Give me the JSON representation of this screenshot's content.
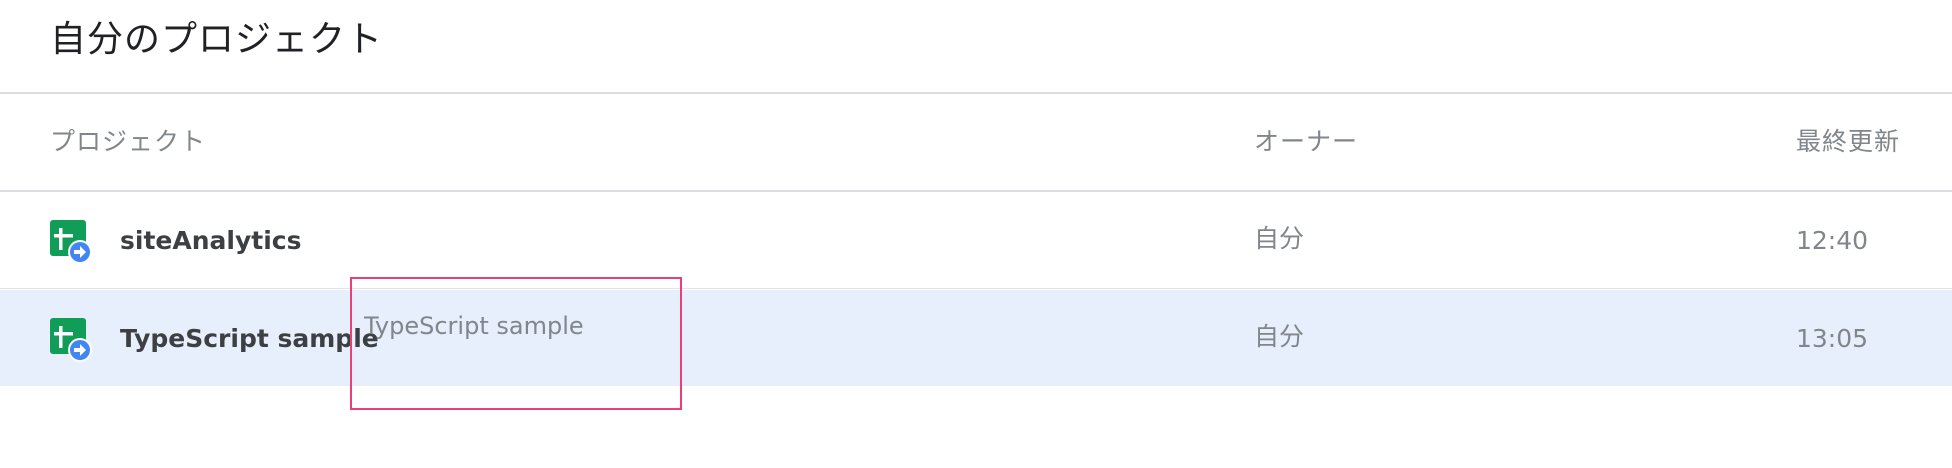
{
  "page": {
    "title": "自分のプロジェクト"
  },
  "columns": {
    "project": "プロジェクト",
    "owner": "オーナー",
    "last_modified": "最終更新"
  },
  "rows": [
    {
      "name": "siteAnalytics",
      "owner": "自分",
      "modified": "12:40",
      "icon": "apps-script-project-icon",
      "selected": false
    },
    {
      "name": "TypeScript sample",
      "owner": "自分",
      "modified": "13:05",
      "icon": "apps-script-project-icon",
      "selected": true
    }
  ],
  "rename": {
    "value": "TypeScript sample",
    "border_color": "#ec3f7a"
  },
  "colors": {
    "icon_green": "#0f9d58",
    "icon_blue": "#4285f4",
    "selected_row": "#e8effc"
  }
}
